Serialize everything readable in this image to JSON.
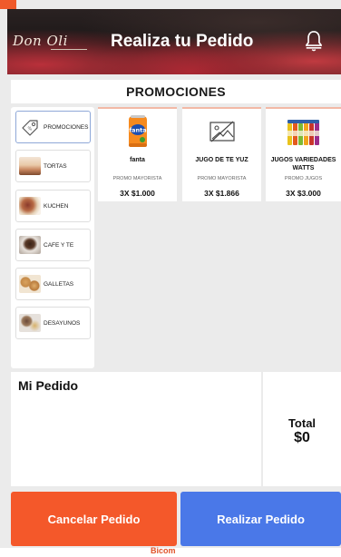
{
  "header": {
    "logo_text": "Don Oli",
    "title": "Realiza tu Pedido",
    "notification_icon": "bell-icon"
  },
  "section_title": "PROMOCIONES",
  "categories": [
    {
      "label": "PROMOCIONES",
      "icon": "tag-icon",
      "active": true
    },
    {
      "label": "TORTAS",
      "icon": "cake-thumbnail",
      "active": false
    },
    {
      "label": "KUCHEN",
      "icon": "kuchen-thumbnail",
      "active": false
    },
    {
      "label": "CAFE Y TE",
      "icon": "coffee-thumbnail",
      "active": false
    },
    {
      "label": "GALLETAS",
      "icon": "cookies-thumbnail",
      "active": false
    },
    {
      "label": "DESAYUNOS",
      "icon": "breakfast-thumbnail",
      "active": false
    }
  ],
  "products": [
    {
      "name": "fanta",
      "type": "PROMO MAYORISTA",
      "price": "3X $1.000",
      "image": "fanta-can-image"
    },
    {
      "name": "JUGO DE TE YUZ",
      "type": "PROMO MAYORISTA",
      "price": "3X $1.866",
      "image": "image-placeholder-icon"
    },
    {
      "name": "JUGOS VARIEDADES WATTS",
      "type": "PROMO JUGOS",
      "price": "3X $3.000",
      "image": "juice-bottles-image"
    }
  ],
  "order": {
    "title": "Mi Pedido",
    "total_label": "Total",
    "total_value": "$0"
  },
  "actions": {
    "cancel_label": "Cancelar Pedido",
    "submit_label": "Realizar Pedido"
  },
  "footer": {
    "brand": "Bicom"
  },
  "colors": {
    "accent_orange": "#f4582a",
    "accent_blue": "#4a78e8",
    "card_top_border": "#f2b9a6"
  }
}
